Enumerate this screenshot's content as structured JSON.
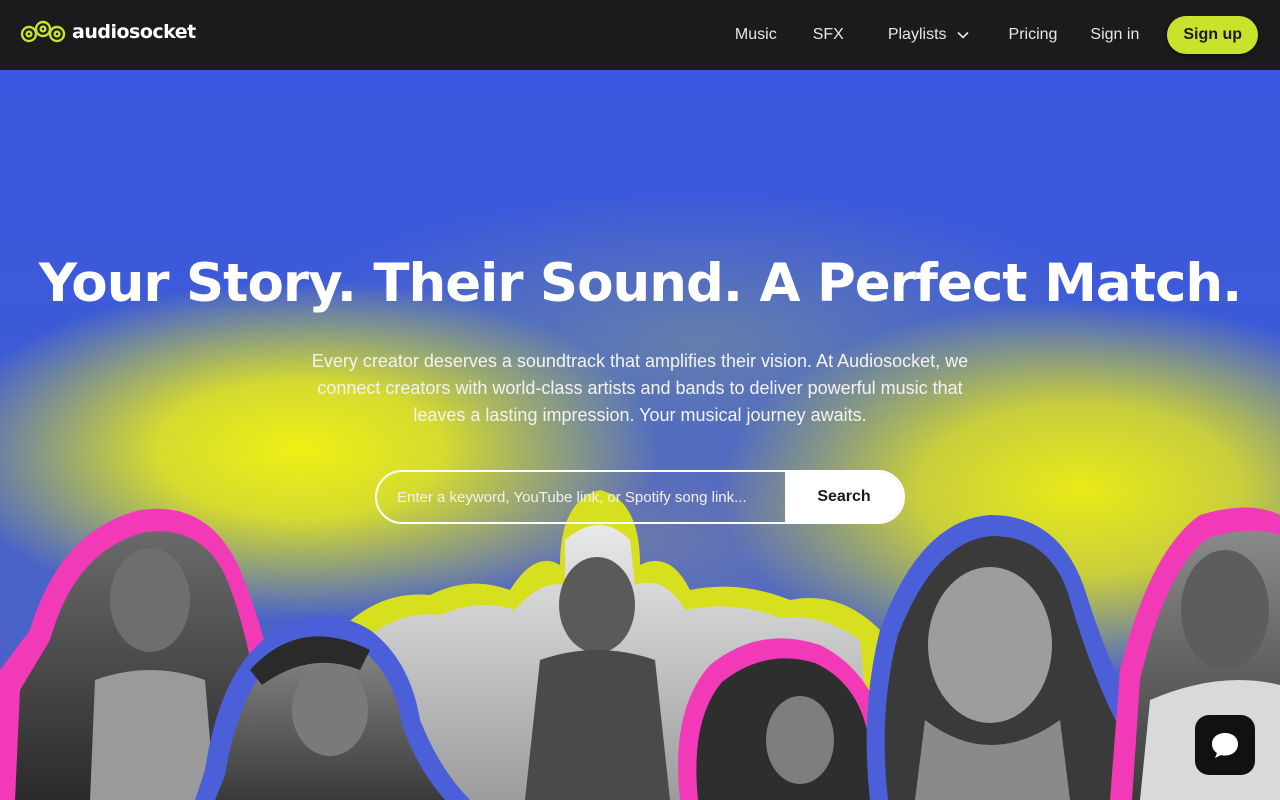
{
  "brand": {
    "name": "audiosocket",
    "logo_color": "#c9e22c"
  },
  "nav": {
    "items": [
      {
        "label": "Music"
      },
      {
        "label": "SFX"
      },
      {
        "label": "Playlists"
      },
      {
        "label": "Pricing"
      },
      {
        "label": "Sign in"
      }
    ],
    "signup_label": "Sign up",
    "accent": "#c9e22c"
  },
  "hero": {
    "title": "Your Story. Their Sound. A Perfect Match.",
    "description": "Every creator deserves a soundtrack that amplifies their vision. At Audiosocket, we connect creators with world-class artists and bands to deliver powerful music that leaves a lasting impression. Your musical journey awaits.",
    "search_placeholder": "Enter a keyword, YouTube link, or Spotify song link...",
    "search_button": "Search"
  },
  "collage": {
    "artists": [
      {
        "outline": "#f23ab9"
      },
      {
        "outline": "#4a5fd8"
      },
      {
        "outline": "#d9e224"
      },
      {
        "outline": "#f23ab9"
      },
      {
        "outline": "#4a5fd8"
      },
      {
        "outline": "#f23ab9"
      }
    ]
  },
  "chat": {
    "icon": "chat-bubble-icon"
  }
}
